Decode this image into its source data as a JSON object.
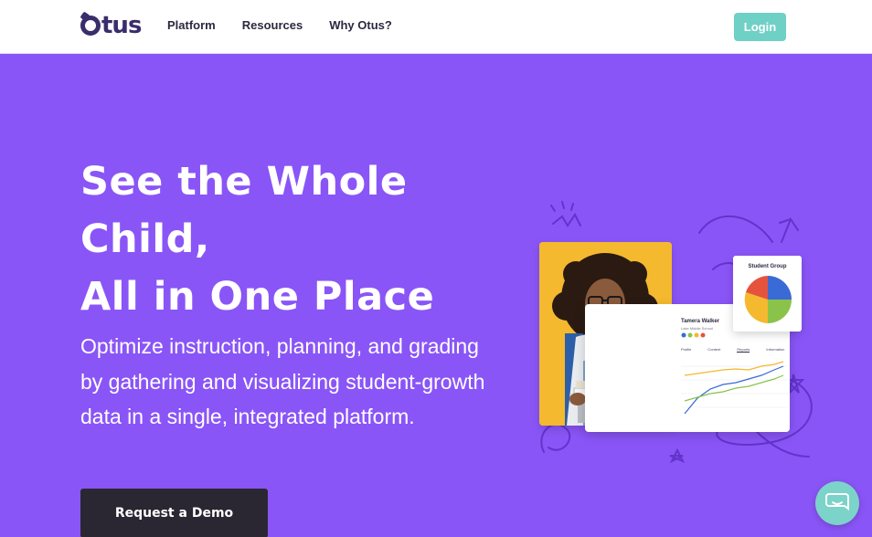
{
  "header": {
    "logo_text": "tus",
    "nav": [
      "Platform",
      "Resources",
      "Why Otus?"
    ],
    "login_label": "Login"
  },
  "hero": {
    "title_lines": [
      "See the Whole",
      "Child,",
      "All in One Place"
    ],
    "subtitle": "Optimize instruction, planning, and grading by gathering and visualizing student-growth data in a single, integrated platform.",
    "cta_label": "Request a Demo"
  },
  "illustration": {
    "pie_title": "Student Group",
    "student_name": "Tamera Walker",
    "student_school": "Lake Middle School",
    "tabs": [
      "Profile",
      "Content",
      "Reports",
      "Information"
    ],
    "active_tab": "Reports"
  },
  "colors": {
    "hero_bg": "#8a55f7",
    "login_bg": "#6fd0c6",
    "cta_bg": "#2a2733",
    "chat_bg": "#7cd3c9"
  },
  "icons": {
    "chat": "chat-bubble-icon"
  }
}
